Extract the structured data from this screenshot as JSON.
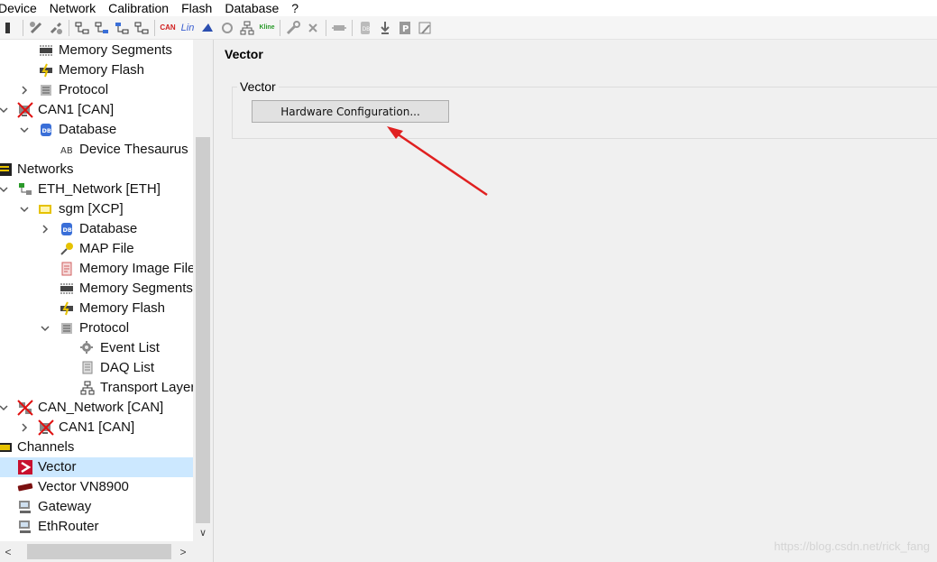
{
  "menu": [
    "Device",
    "Network",
    "Calibration",
    "Flash",
    "Database",
    "?"
  ],
  "toolbar": {
    "can_text": "CAN",
    "lin_text": "Lin",
    "kline_text": "Kline"
  },
  "tree": [
    {
      "label": "Memory Segments",
      "icon": "memory-segments-icon",
      "indent": 1,
      "expander": "none"
    },
    {
      "label": "Memory Flash",
      "icon": "memory-flash-icon",
      "indent": 1,
      "expander": "none"
    },
    {
      "label": "Protocol",
      "icon": "protocol-icon",
      "indent": 1,
      "expander": "collapsed"
    },
    {
      "label": "CAN1 [CAN]",
      "icon": "can-device-error-icon",
      "indent": 0,
      "expander": "expanded"
    },
    {
      "label": "Database",
      "icon": "database-icon",
      "indent": 1,
      "expander": "expanded"
    },
    {
      "label": "Device Thesaurus",
      "icon": "thesaurus-icon",
      "indent": 2,
      "expander": "none"
    },
    {
      "label": "Networks",
      "icon": "networks-icon",
      "indent": -1,
      "expander": "none"
    },
    {
      "label": "ETH_Network [ETH]",
      "icon": "eth-network-icon",
      "indent": 0,
      "expander": "expanded"
    },
    {
      "label": "sgm [XCP]",
      "icon": "xcp-device-icon",
      "indent": 1,
      "expander": "expanded"
    },
    {
      "label": "Database",
      "icon": "database-icon",
      "indent": 2,
      "expander": "collapsed"
    },
    {
      "label": "MAP File",
      "icon": "map-file-icon",
      "indent": 2,
      "expander": "none"
    },
    {
      "label": "Memory Image File",
      "icon": "memory-image-icon",
      "indent": 2,
      "expander": "none"
    },
    {
      "label": "Memory Segments",
      "icon": "memory-segments-icon",
      "indent": 2,
      "expander": "none"
    },
    {
      "label": "Memory Flash",
      "icon": "memory-flash-icon",
      "indent": 2,
      "expander": "none"
    },
    {
      "label": "Protocol",
      "icon": "protocol-icon",
      "indent": 2,
      "expander": "expanded"
    },
    {
      "label": "Event List",
      "icon": "event-list-icon",
      "indent": 3,
      "expander": "none"
    },
    {
      "label": "DAQ List",
      "icon": "daq-list-icon",
      "indent": 3,
      "expander": "none"
    },
    {
      "label": "Transport Layer",
      "icon": "transport-layer-icon",
      "indent": 3,
      "expander": "none"
    },
    {
      "label": "CAN_Network [CAN]",
      "icon": "can-network-error-icon",
      "indent": 0,
      "expander": "expanded"
    },
    {
      "label": "CAN1 [CAN]",
      "icon": "can-device-error-icon",
      "indent": 1,
      "expander": "collapsed"
    },
    {
      "label": "Channels",
      "icon": "channels-icon",
      "indent": -1,
      "expander": "none"
    },
    {
      "label": "Vector",
      "icon": "vector-icon",
      "indent": 0,
      "expander": "none",
      "selected": true
    },
    {
      "label": "Vector VN8900",
      "icon": "vn8900-icon",
      "indent": 0,
      "expander": "none"
    },
    {
      "label": "Gateway",
      "icon": "gateway-icon",
      "indent": 0,
      "expander": "none"
    },
    {
      "label": "EthRouter",
      "icon": "ethrouter-icon",
      "indent": 0,
      "expander": "none"
    }
  ],
  "content": {
    "title": "Vector",
    "group_title": "Vector",
    "hw_button_label": "Hardware Configuration..."
  },
  "watermark": "https://blog.csdn.net/rick_fang",
  "colors": {
    "selection": "#cce8ff",
    "arrow": "#e02020"
  }
}
